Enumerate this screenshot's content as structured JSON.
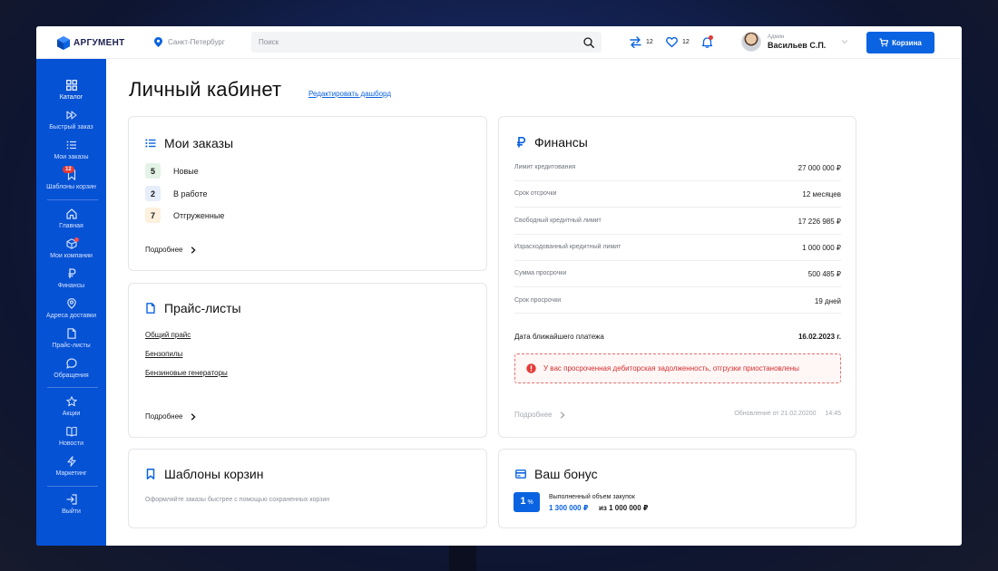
{
  "header": {
    "logo_text": "АРГУМЕНТ",
    "city": "Санкт-Петербург",
    "search_placeholder": "Поиск",
    "compare_count": "12",
    "favorites_count": "12",
    "user_role": "Админ",
    "user_name": "Васильев С.П.",
    "cart_label": "Корзина"
  },
  "sidebar": {
    "items": [
      {
        "label": "Каталог",
        "icon": "grid-icon"
      },
      {
        "label": "Быстрый заказ",
        "icon": "fast-forward-icon"
      },
      {
        "label": "Мои заказы",
        "icon": "list-icon"
      },
      {
        "label": "Шаблоны корзин",
        "icon": "bookmark-icon",
        "badge": "12"
      },
      {
        "label": "Главная",
        "icon": "home-icon"
      },
      {
        "label": "Мои компании",
        "icon": "cube-icon"
      },
      {
        "label": "Финансы",
        "icon": "ruble-icon"
      },
      {
        "label": "Адреса доставки",
        "icon": "location-icon"
      },
      {
        "label": "Прайс-листы",
        "icon": "document-icon"
      },
      {
        "label": "Обращения",
        "icon": "chat-icon"
      },
      {
        "label": "Акции",
        "icon": "star-icon"
      },
      {
        "label": "Новости",
        "icon": "book-icon"
      },
      {
        "label": "Маркетинг",
        "icon": "lightning-icon"
      },
      {
        "label": "Выйти",
        "icon": "logout-icon"
      }
    ]
  },
  "page": {
    "title": "Личный кабинет",
    "edit_link": "Редактировать дашборд"
  },
  "orders": {
    "title": "Мои заказы",
    "rows": [
      {
        "count": "5",
        "label": "Новые",
        "color": "#e3f4e6"
      },
      {
        "count": "2",
        "label": "В работе",
        "color": "#e6eefb"
      },
      {
        "count": "7",
        "label": "Отгруженные",
        "color": "#fdf0dc"
      }
    ],
    "more": "Подробнее"
  },
  "prices": {
    "title": "Прайс-листы",
    "links": [
      "Общий прайс",
      "Бензопилы",
      "Бензиновые генераторы"
    ],
    "more": "Подробнее"
  },
  "templates": {
    "title": "Шаблоны корзин",
    "description": "Оформляйте заказы быстрее с помощью сохраненных корзин"
  },
  "finance": {
    "title": "Финансы",
    "rows": [
      {
        "label": "Лимит кредитования",
        "value": "27 000 000 ₽"
      },
      {
        "label": "Срок отсрочки",
        "value": "12 месяцев"
      },
      {
        "label": "Свободный кредитный лимит",
        "value": "17 226 985 ₽"
      },
      {
        "label": "Израсходованный кредитный лимит",
        "value": "1 000 000 ₽"
      },
      {
        "label": "Сумма просрочки",
        "value": "500 485 ₽"
      },
      {
        "label": "Срок просрочки",
        "value": "19 дней"
      }
    ],
    "next_payment_label": "Дата ближайшего платежа",
    "next_payment_value": "16.02.2023 г.",
    "alert": "У вас просроченная дебиторская задолженность, отгрузки приостановлены",
    "more": "Подробнее",
    "updated_label": "Обновление от",
    "updated_date": "21.02.20200",
    "updated_time": "14:45"
  },
  "bonus": {
    "title": "Ваш бонус",
    "percent": "1",
    "percent_sign": "%",
    "caption": "Выполненный объем закупок",
    "done": "1 300 000 ₽",
    "of": "из 1 000 000 ₽"
  },
  "colors": {
    "accent": "#0a63e0",
    "sidebar": "#0652d4",
    "alert": "#d32f2f"
  }
}
